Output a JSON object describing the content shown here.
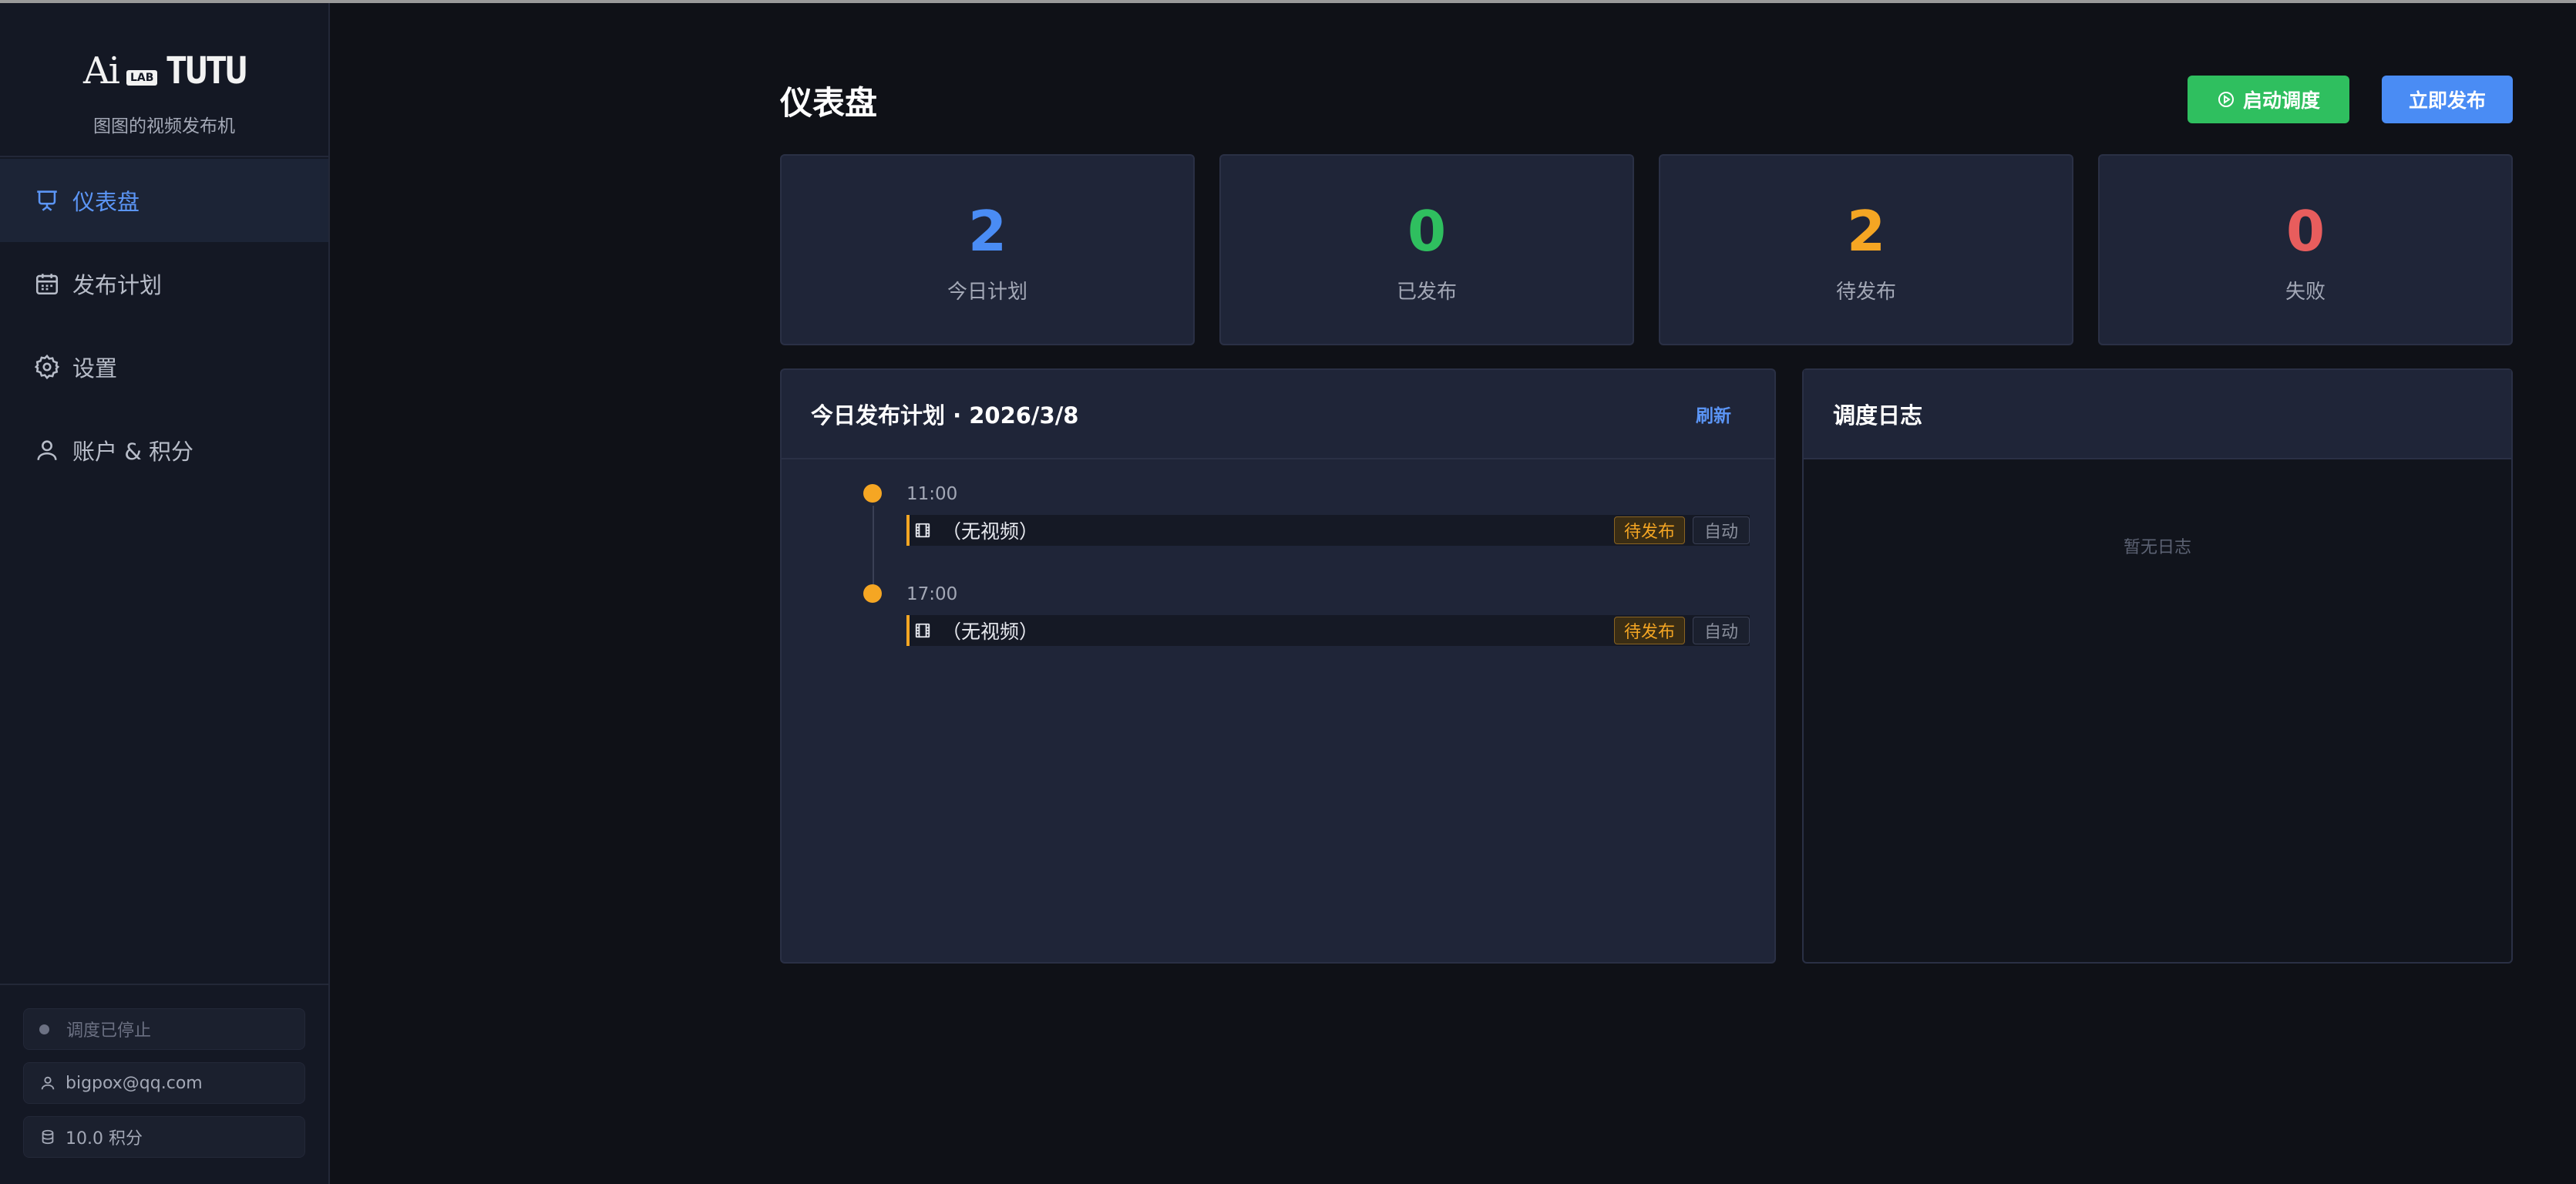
{
  "brand": {
    "logo_ai": "Ai",
    "logo_lab": "LAB",
    "logo_tutu": "TUTU",
    "subtitle": "图图的视频发布机"
  },
  "nav": {
    "items": [
      {
        "label": "仪表盘",
        "icon": "presentation-icon",
        "active": true
      },
      {
        "label": "发布计划",
        "icon": "calendar-icon",
        "active": false
      },
      {
        "label": "设置",
        "icon": "gear-icon",
        "active": false
      },
      {
        "label": "账户 & 积分",
        "icon": "user-icon",
        "active": false
      }
    ]
  },
  "footer": {
    "status": "调度已停止",
    "email": "bigpox@qq.com",
    "points": "10.0 积分"
  },
  "header": {
    "title": "仪表盘",
    "start_button": "启动调度",
    "publish_button": "立即发布"
  },
  "stats": [
    {
      "value": "2",
      "label": "今日计划",
      "color": "#4a8cf4"
    },
    {
      "value": "0",
      "label": "已发布",
      "color": "#2fbf5f"
    },
    {
      "value": "2",
      "label": "待发布",
      "color": "#f5a623"
    },
    {
      "value": "0",
      "label": "失败",
      "color": "#e85d5d"
    }
  ],
  "plan": {
    "title": "今日发布计划 · 2026/3/8",
    "refresh": "刷新",
    "items": [
      {
        "time": "11:00",
        "title": "（无视频）",
        "status": "待发布",
        "mode": "自动"
      },
      {
        "time": "17:00",
        "title": "（无视频）",
        "status": "待发布",
        "mode": "自动"
      }
    ]
  },
  "log": {
    "title": "调度日志",
    "empty": "暂无日志"
  }
}
